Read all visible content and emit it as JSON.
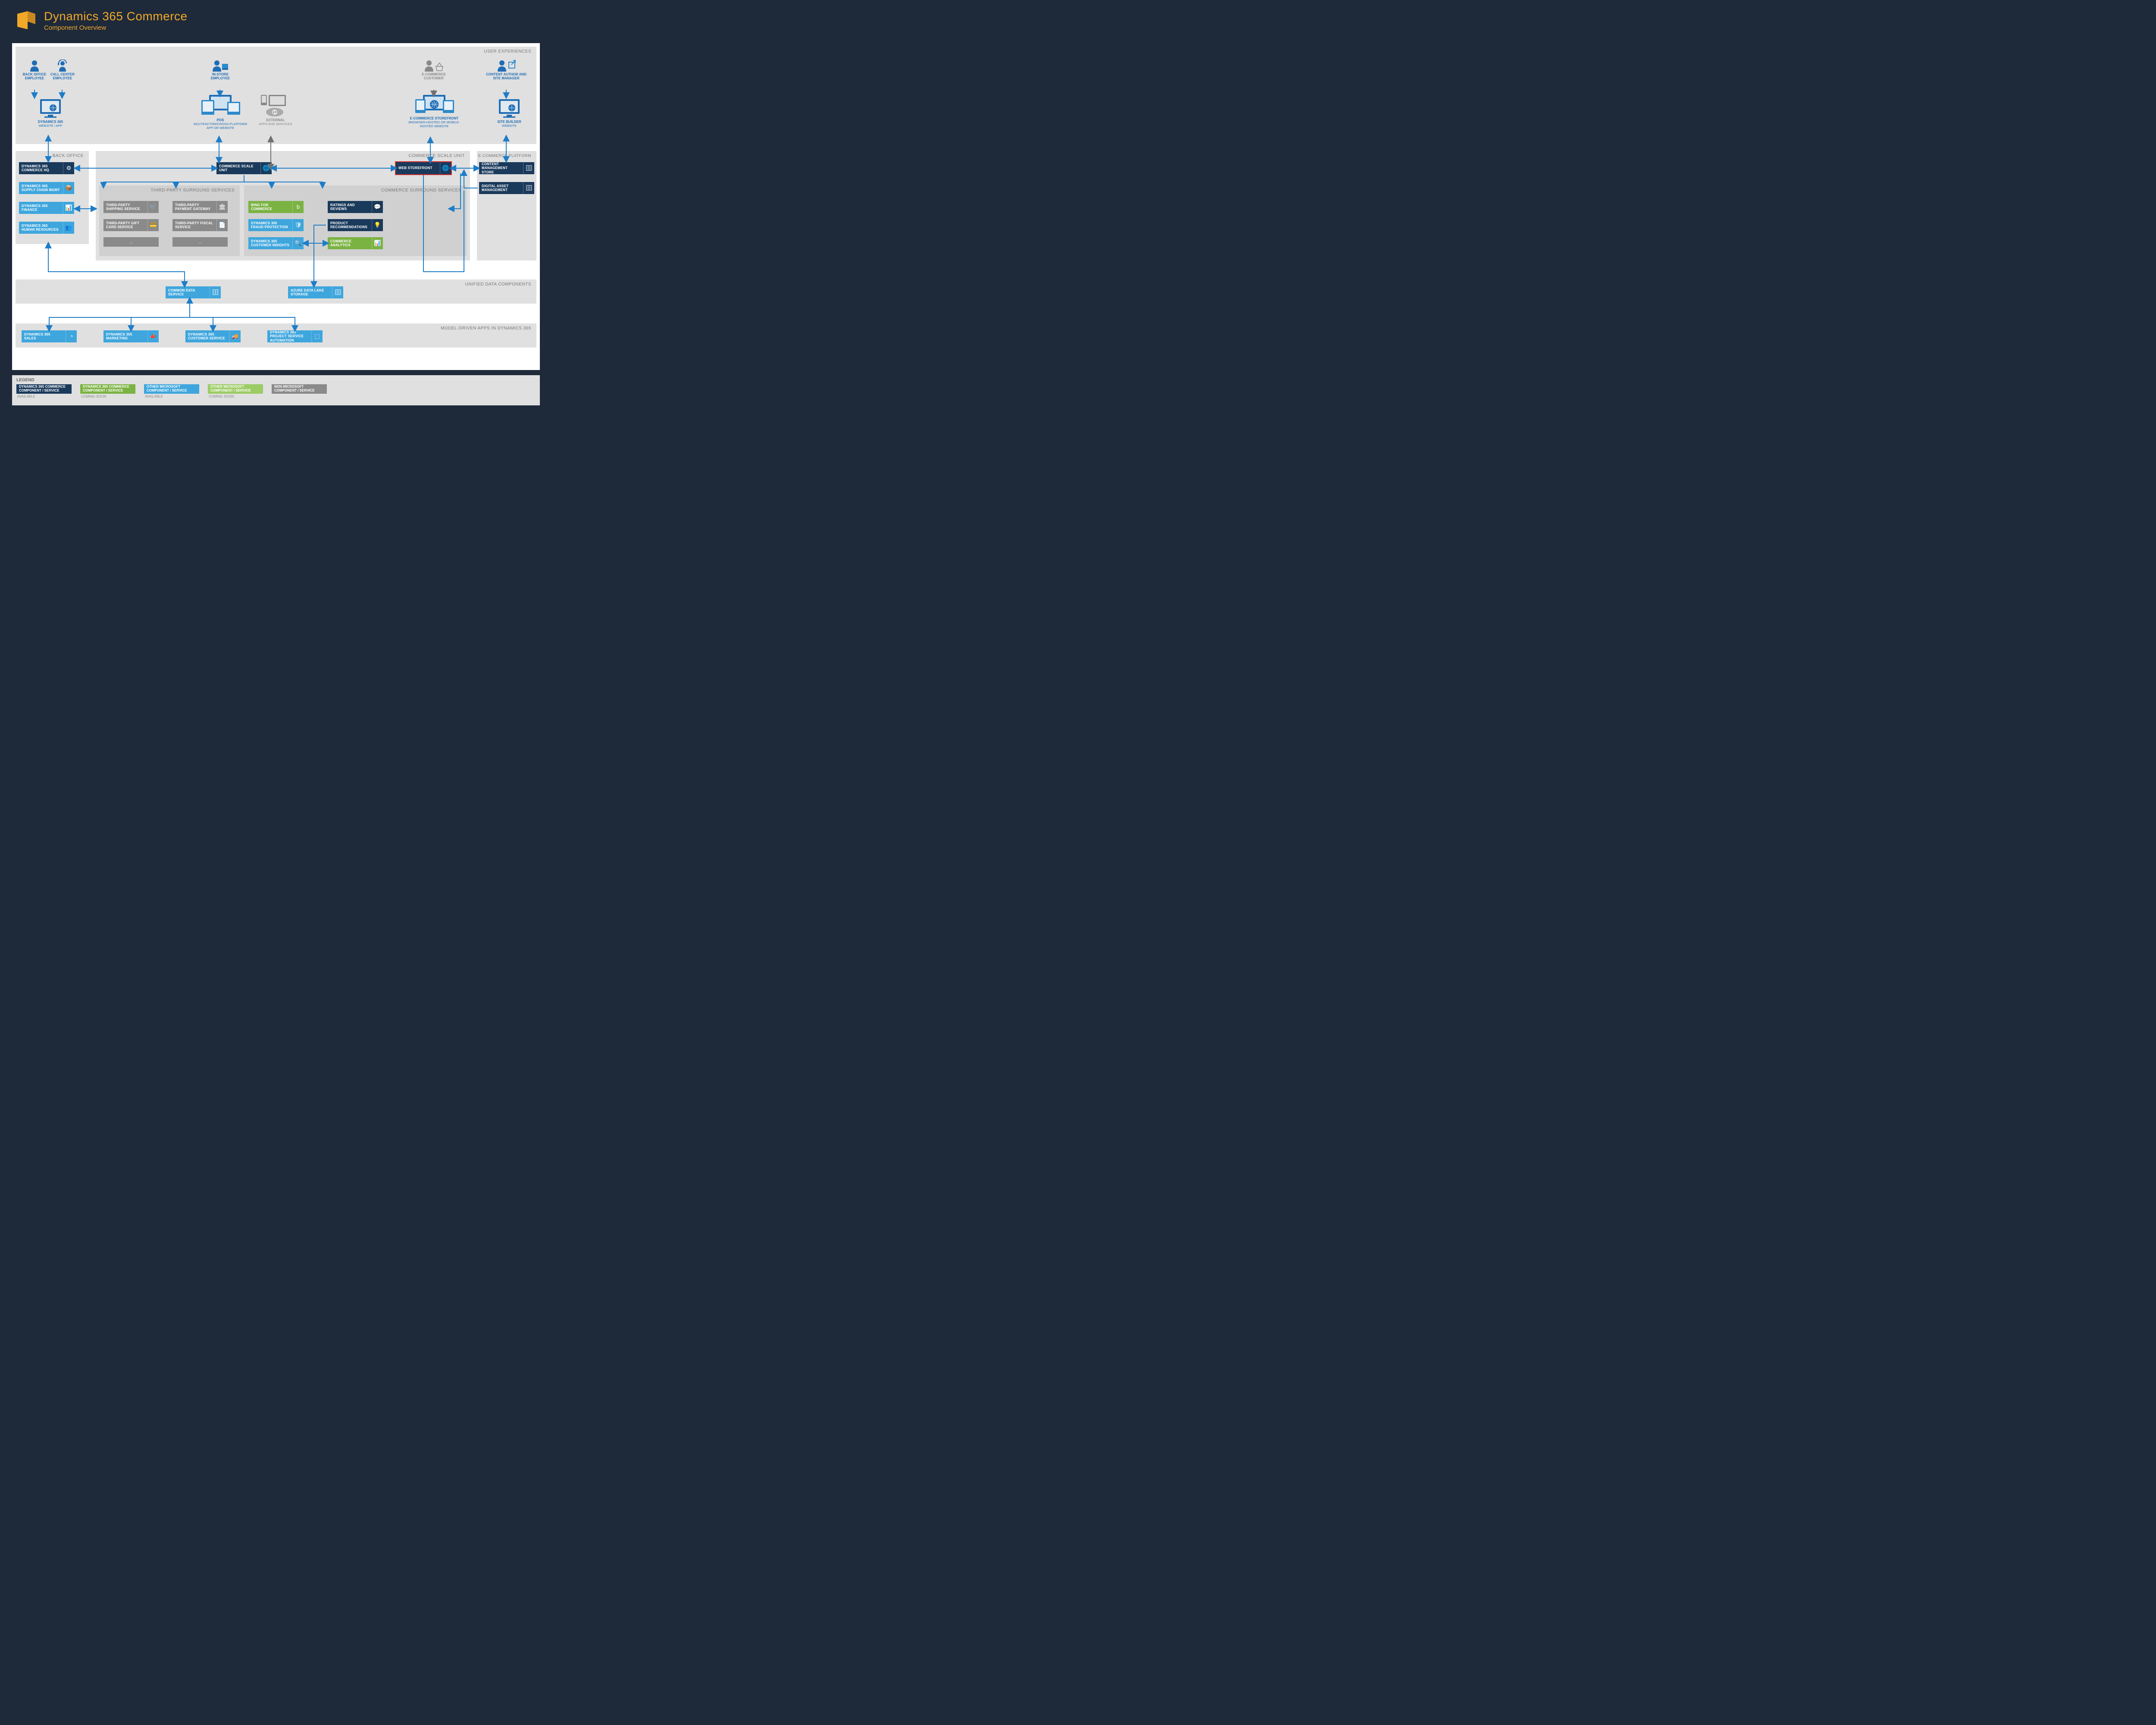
{
  "header": {
    "title": "Dynamics 365 Commerce",
    "subtitle": "Component Overview"
  },
  "sections": {
    "user_experiences": "USER EXPERIENCES",
    "back_office": "BACK OFFICE",
    "commerce_scale_unit": "COMMERCE SCALE UNIT",
    "ecommerce_platform": "E-COMMERCE PLATFORM",
    "third_party": "THIRD-PARTY SURROUND SERVICES",
    "commerce_surround": "COMMERCE SURROUND SERVICES",
    "unified_data": "UNIFIED DATA COMPONENTS",
    "model_driven": "MODEL-DRIVEN APPS IN DYNAMICS 365"
  },
  "personas": {
    "back_office_emp": "BACK OFFICE EMPLOYEE",
    "call_center_emp": "CALL CENTER EMPLOYEE",
    "in_store_emp": "IN-STORE EMPLOYEE",
    "ecom_customer": "E-COMMERCE CUSTOMER",
    "content_author": "CONTENT AUTHOR AND SITE MANAGER"
  },
  "devices": {
    "d365": {
      "title": "DYNAMICS 365",
      "sub": "WEBSITE / APP"
    },
    "pos": {
      "title": "POS",
      "sub": "MULTIFACTOR/CROSS-PLATFORM APP OR WEBSITE"
    },
    "external": {
      "title": "EXTERNAL",
      "sub": "APPS AND SERVICES"
    },
    "storefront": {
      "title": "E-COMMERCE STOREFRONT",
      "sub": "BROWSER-HOSTED OR MOBILE-HOSTED WEBSITE"
    },
    "site_builder": {
      "title": "SITE BUILDER",
      "sub": "WEBSITE"
    }
  },
  "back_office_comps": {
    "hq": "DYNAMICS 365 COMMERCE HQ",
    "scm": "DYNAMICS 365 SUPPLY CHAIN MGMT",
    "fin": "DYNAMICS 365 FINANCE",
    "hr": "DYNAMICS 365 HUMAN RESOURCES"
  },
  "csu": {
    "scale_unit": "COMMERCE SCALE UNIT",
    "web_storefront": "WEB STOREFRONT"
  },
  "ecom_platform": {
    "cms": "CONTENT MANAGEMENT STORE",
    "dam": "DIGITAL ASSET MANAGEMENT"
  },
  "third_party_comps": {
    "shipping": "THIRD-PARTY SHIPPING SERVICE",
    "payment": "THIRD-PARTY PAYMENT GATEWAY",
    "giftcard": "THIRD-PARTY GIFT CARD SERVICE",
    "fiscal": "THIRD-PARTY FISCAL SERVICE",
    "more1": "...",
    "more2": "..."
  },
  "commerce_surround_comps": {
    "bing": "BING FOR COMMERCE",
    "fraud": "DYNAMICS 365 FRAUD PROTECTION",
    "insights": "DYNAMICS 365 CUSTOMER INSIGHTS",
    "ratings": "RATINGS AND REVIEWS",
    "recommend": "PRODUCT RECOMMENDATIONS",
    "analytics": "COMMERCE ANALYTICS"
  },
  "unified": {
    "cds": "COMMON DATA SERVICE",
    "adls": "AZURE DATA LAKE STORAGE"
  },
  "model_apps": {
    "sales": "DYNAMICS 365 SALES",
    "marketing": "DYNAMICS 365 MARKETING",
    "cs": "DYNAMICS 365 CUSTOMER SERVICE",
    "psa": "DYNAMICS 365 PROJECT SERVICE AUTOMATION"
  },
  "legend": {
    "title": "LEGEND",
    "items": [
      {
        "label": "DYNAMICS 365 COMMERCE COMPONENT / SERVICE",
        "status": "AVAILABLE",
        "color": "#1a3a5c"
      },
      {
        "label": "DYNAMICS 365 COMMERCE COMPONENT / SERVICE",
        "status": "COMING SOON",
        "color": "#7bb342"
      },
      {
        "label": "OTHER MICROSOFT COMPONENT / SERVICE",
        "status": "AVAILABLE",
        "color": "#3ea6dd"
      },
      {
        "label": "OTHER MICROSOFT COMPONENT / SERVICE",
        "status": "COMING SOON",
        "color": "#9ccc65"
      },
      {
        "label": "NON-MICROSOFT COMPONENT / SERVICE",
        "status": "",
        "color": "#8a8a8a"
      }
    ]
  }
}
